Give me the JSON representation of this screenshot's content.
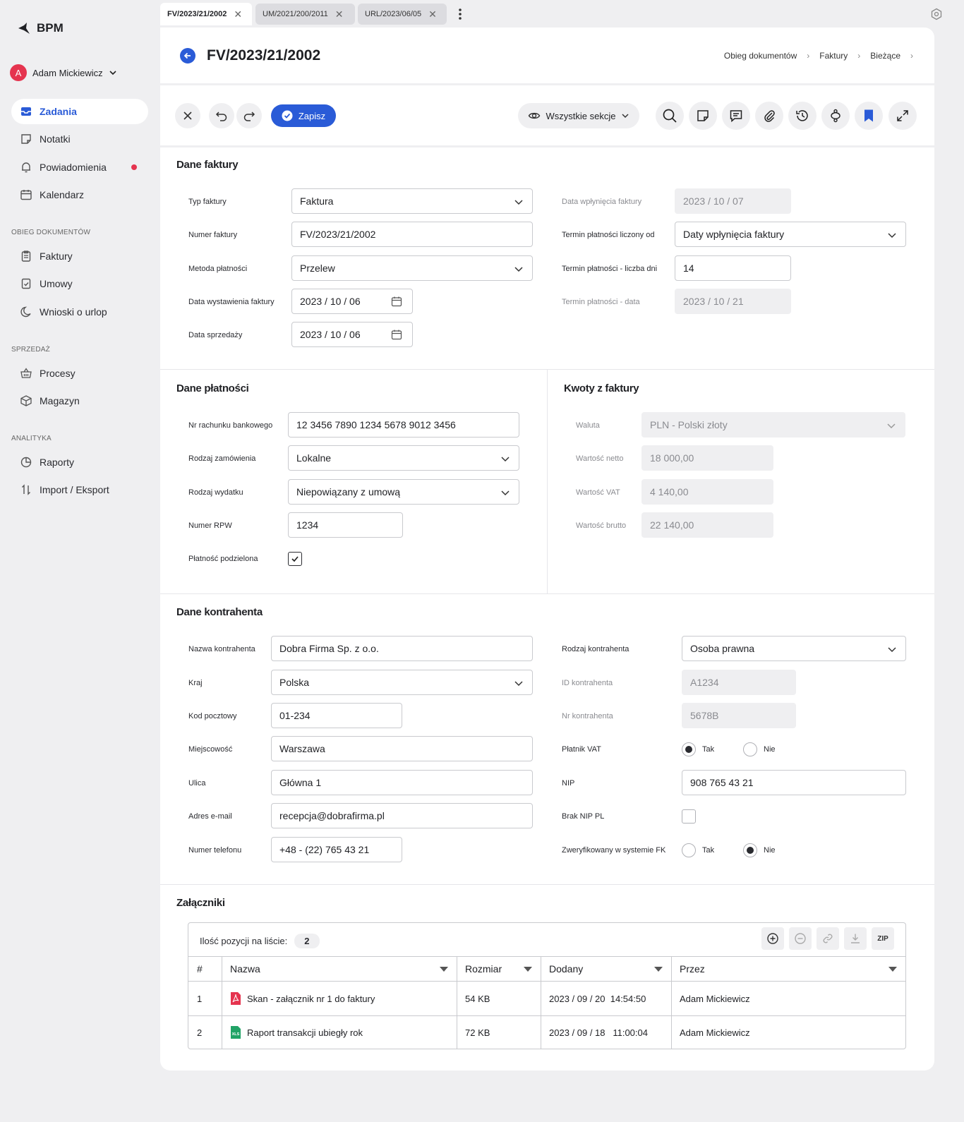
{
  "app": {
    "name": "BPM",
    "user": "Adam Mickiewicz",
    "avatar_initial": "A"
  },
  "sidebar": {
    "main": [
      {
        "label": "Zadania",
        "icon": "inbox-icon"
      },
      {
        "label": "Notatki",
        "icon": "note-icon"
      },
      {
        "label": "Powiadomienia",
        "icon": "bell-icon"
      },
      {
        "label": "Kalendarz",
        "icon": "calendar-icon"
      }
    ],
    "sections": [
      {
        "title": "OBIEG DOKUMENTÓW",
        "items": [
          {
            "label": "Faktury"
          },
          {
            "label": "Umowy"
          },
          {
            "label": "Wnioski o urlop"
          }
        ]
      },
      {
        "title": "SPRZEDAŻ",
        "items": [
          {
            "label": "Procesy"
          },
          {
            "label": "Magazyn"
          }
        ]
      },
      {
        "title": "ANALITYKA",
        "items": [
          {
            "label": "Raporty"
          },
          {
            "label": "Import / Eksport"
          }
        ]
      }
    ]
  },
  "tabs": [
    "FV/2023/21/2002",
    "UM/2021/200/2011",
    "URL/2023/06/05"
  ],
  "header": {
    "title": "FV/2023/21/2002",
    "breadcrumb": [
      "Obieg dokumentów",
      "Faktury",
      "Bieżące"
    ]
  },
  "toolbar": {
    "save": "Zapisz",
    "sections": "Wszystkie sekcje"
  },
  "invoice": {
    "title": "Dane faktury",
    "typ_label": "Typ faktury",
    "typ": "Faktura",
    "numer_label": "Numer faktury",
    "numer": "FV/2023/21/2002",
    "metoda_label": "Metoda płatności",
    "metoda": "Przelew",
    "wyst_label": "Data wystawienia faktury",
    "wyst": "2023 / 10 / 06",
    "sprz_label": "Data sprzedaży",
    "sprz": "2023 / 10 / 06",
    "wplyw_label": "Data wpłynięcia faktury",
    "wplyw": "2023 / 10 / 07",
    "od_label": "Termin płatności liczony od",
    "od": "Daty wpłynięcia faktury",
    "dni_label": "Termin płatności - liczba dni",
    "dni": "14",
    "tdata_label": "Termin płatności - data",
    "tdata": "2023 / 10 / 21"
  },
  "payment": {
    "title": "Dane płatności",
    "konto_label": "Nr rachunku bankowego",
    "konto": "12 3456 7890 1234 5678 9012 3456",
    "zam_label": "Rodzaj zamówienia",
    "zam": "Lokalne",
    "wyd_label": "Rodzaj wydatku",
    "wyd": "Niepowiązany z umową",
    "rpw_label": "Numer RPW",
    "rpw": "1234",
    "split_label": "Płatność podzielona"
  },
  "amounts": {
    "title": "Kwoty z faktury",
    "waluta_label": "Waluta",
    "waluta": "PLN - Polski złoty",
    "netto_label": "Wartość netto",
    "netto": "18 000,00",
    "vat_label": "Wartość VAT",
    "vat": "4 140,00",
    "brutto_label": "Wartość brutto",
    "brutto": "22 140,00"
  },
  "contractor": {
    "title": "Dane kontrahenta",
    "nazwa_label": "Nazwa kontrahenta",
    "nazwa": "Dobra Firma Sp. z o.o.",
    "kraj_label": "Kraj",
    "kraj": "Polska",
    "kod_label": "Kod pocztowy",
    "kod": "01-234",
    "miasto_label": "Miejscowość",
    "miasto": "Warszawa",
    "ulica_label": "Ulica",
    "ulica": "Główna 1",
    "email_label": "Adres e-mail",
    "email": "recepcja@dobrafirma.pl",
    "tel_label": "Numer telefonu",
    "tel": "+48 - (22) 765 43 21",
    "rodzaj_label": "Rodzaj kontrahenta",
    "rodzaj": "Osoba prawna",
    "id_label": "ID kontrahenta",
    "id": "A1234",
    "nr_label": "Nr kontrahenta",
    "nr": "5678B",
    "vat_label": "Płatnik VAT",
    "tak": "Tak",
    "nie": "Nie",
    "nip_label": "NIP",
    "nip": "908 765 43 21",
    "brak_label": "Brak NIP PL",
    "fk_label": "Zweryfikowany w systemie FK"
  },
  "attachments": {
    "title": "Załączniki",
    "count_label": "Ilość pozycji na liście:",
    "count": "2",
    "zip": "ZIP",
    "columns": [
      "#",
      "Nazwa",
      "Rozmiar",
      "Dodany",
      "Przez"
    ],
    "rows": [
      {
        "n": "1",
        "name": "Skan - załącznik nr 1 do faktury",
        "size": "54 KB",
        "date": "2023 / 09 / 20  14:54:50",
        "by": "Adam Mickiewicz",
        "icon": "pdf-icon"
      },
      {
        "n": "2",
        "name": "Raport transakcji ubiegły rok",
        "size": "72 KB",
        "date": "2023 / 09 / 18   11:00:04",
        "by": "Adam Mickiewicz",
        "icon": "xls-icon"
      }
    ]
  }
}
